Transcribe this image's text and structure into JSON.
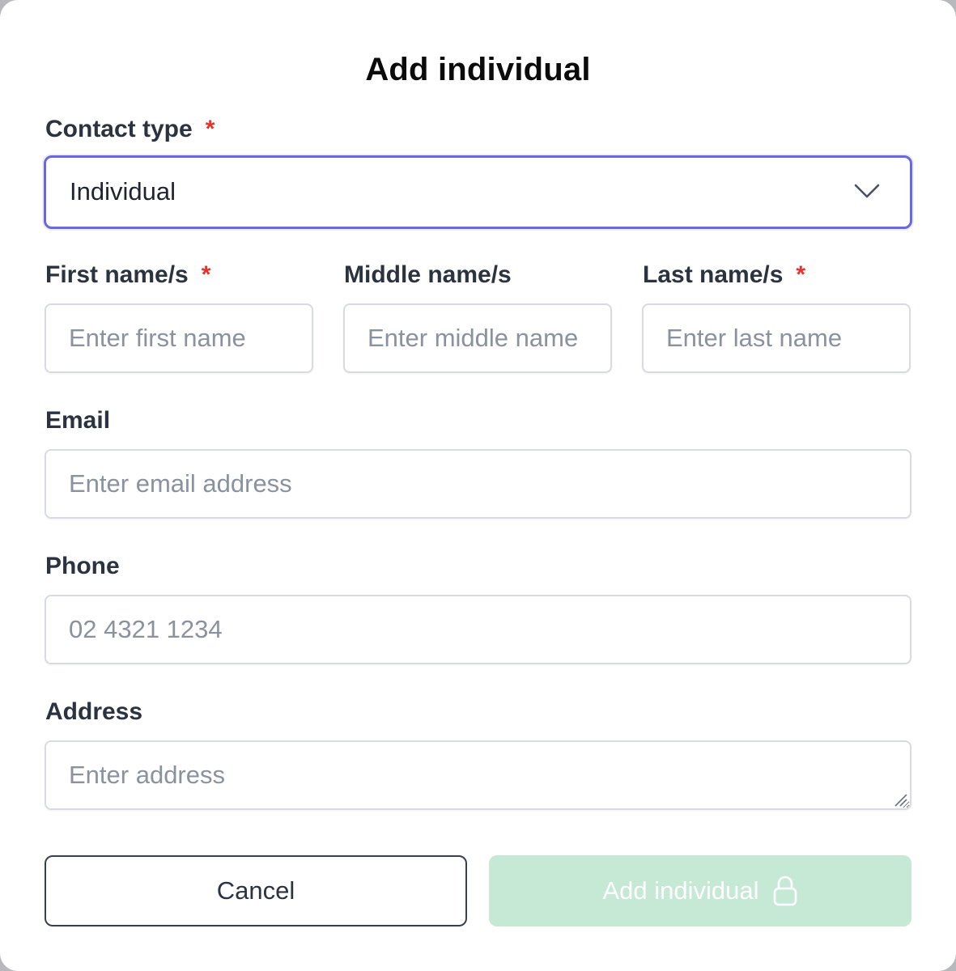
{
  "dialog": {
    "title": "Add individual"
  },
  "contact_type": {
    "label": "Contact type",
    "required_mark": "*",
    "selected": "Individual",
    "icon": "chevron-down-icon"
  },
  "first_name": {
    "label": "First name/s",
    "required_mark": "*",
    "placeholder": "Enter first name"
  },
  "middle_name": {
    "label": "Middle name/s",
    "placeholder": "Enter middle name"
  },
  "last_name": {
    "label": "Last name/s",
    "required_mark": "*",
    "placeholder": "Enter last name"
  },
  "email": {
    "label": "Email",
    "placeholder": "Enter email address"
  },
  "phone": {
    "label": "Phone",
    "placeholder": "02 4321 1234"
  },
  "address": {
    "label": "Address",
    "placeholder": "Enter address"
  },
  "actions": {
    "cancel_label": "Cancel",
    "submit_label": "Add individual",
    "submit_icon": "lock-icon",
    "submit_disabled": true
  },
  "colors": {
    "accent": "#6a67e0",
    "required": "#e5322d",
    "submit_disabled_bg": "#c6e9d5",
    "label_text": "#2b3240",
    "placeholder_text": "#8a92a0"
  }
}
